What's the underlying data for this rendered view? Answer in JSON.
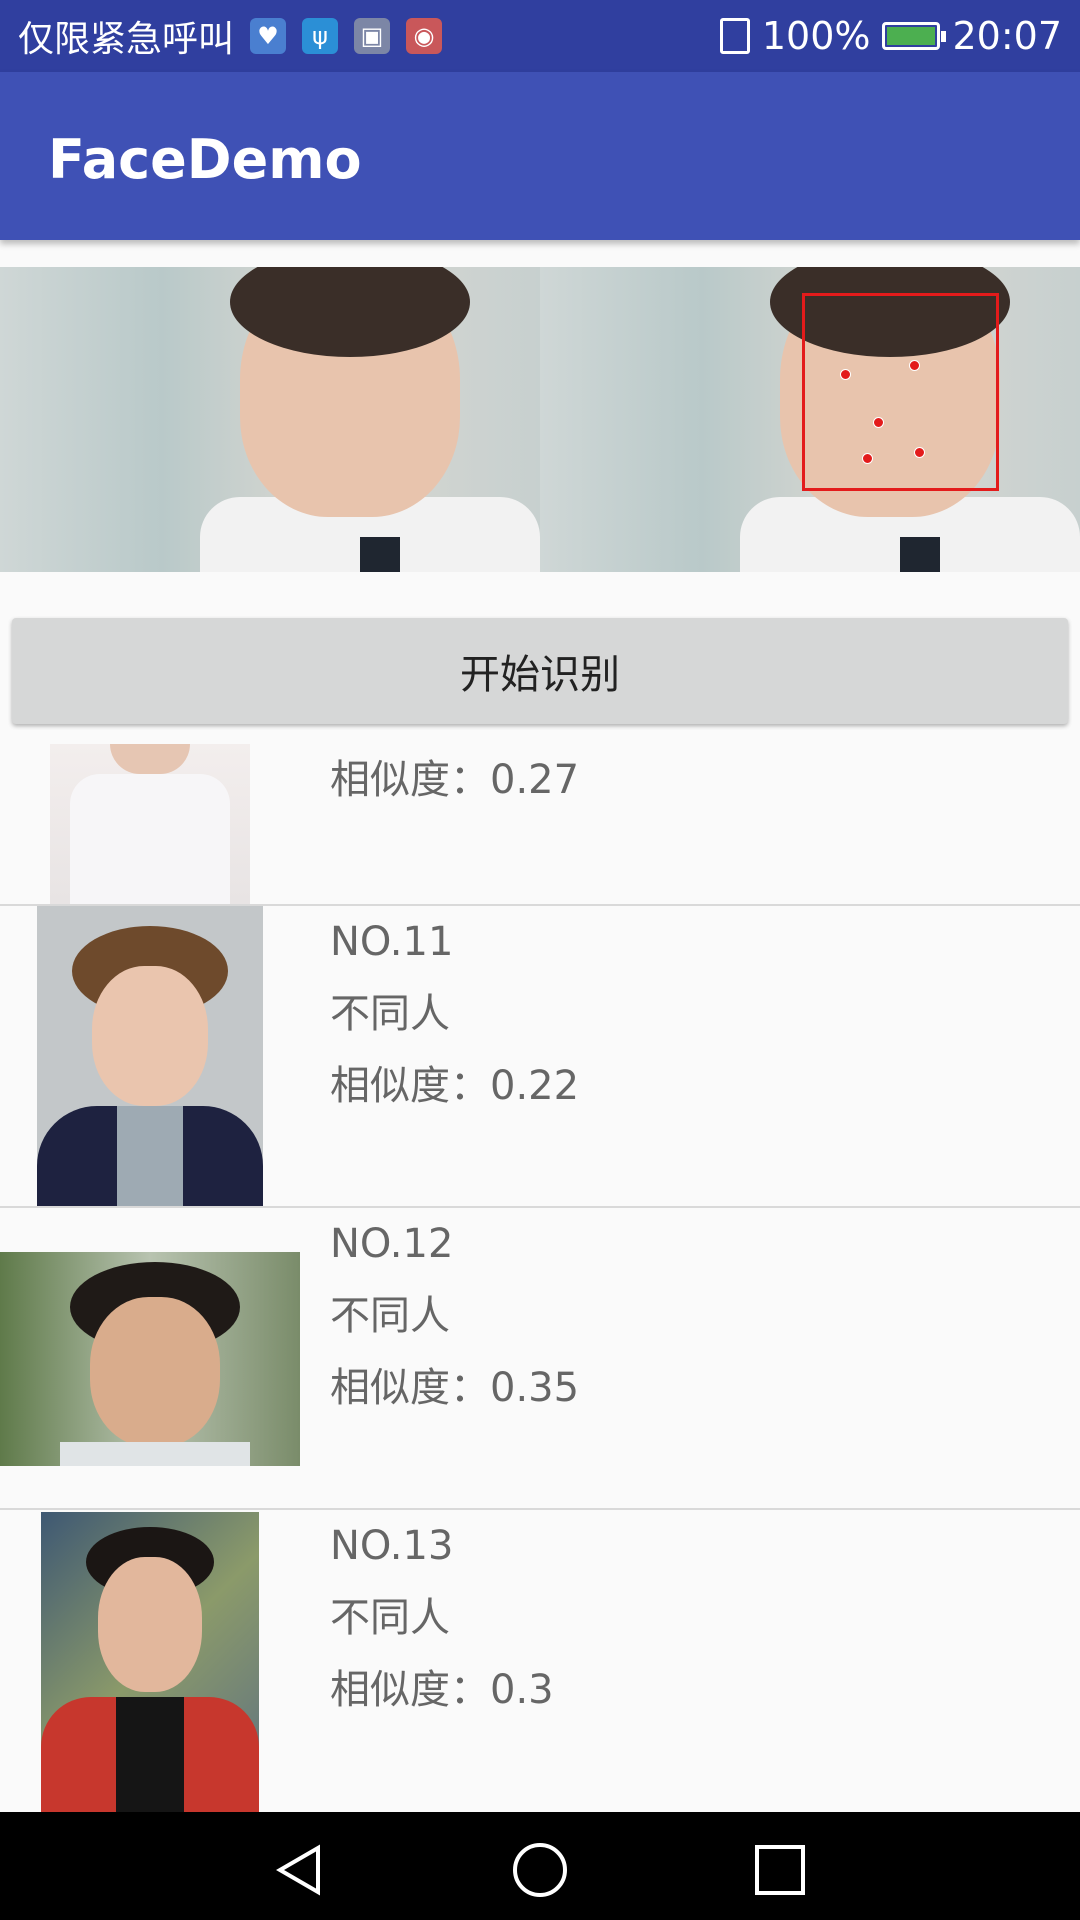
{
  "status_bar": {
    "carrier": "仅限紧急呼叫",
    "icons": [
      "health-icon",
      "usb-icon",
      "gallery-icon",
      "screen-record-icon"
    ],
    "battery_percent": "100%",
    "battery_level": 1.0,
    "time": "20:07"
  },
  "app_bar": {
    "title": "FaceDemo"
  },
  "start_button": {
    "label": "开始识别"
  },
  "results": [
    {
      "similarity": "相似度：0.27"
    },
    {
      "number": "NO.11",
      "verdict": "不同人",
      "similarity": "相似度：0.22"
    },
    {
      "number": "NO.12",
      "verdict": "不同人",
      "similarity": "相似度：0.35"
    },
    {
      "number": "NO.13",
      "verdict": "不同人",
      "similarity": "相似度：0.3"
    }
  ],
  "nav_bar": {
    "buttons": [
      "back-icon",
      "home-icon",
      "recents-icon"
    ]
  },
  "colors": {
    "primary": "#3f51b5",
    "primary_dark": "#303f9f",
    "face_box": "#e31b1b"
  }
}
